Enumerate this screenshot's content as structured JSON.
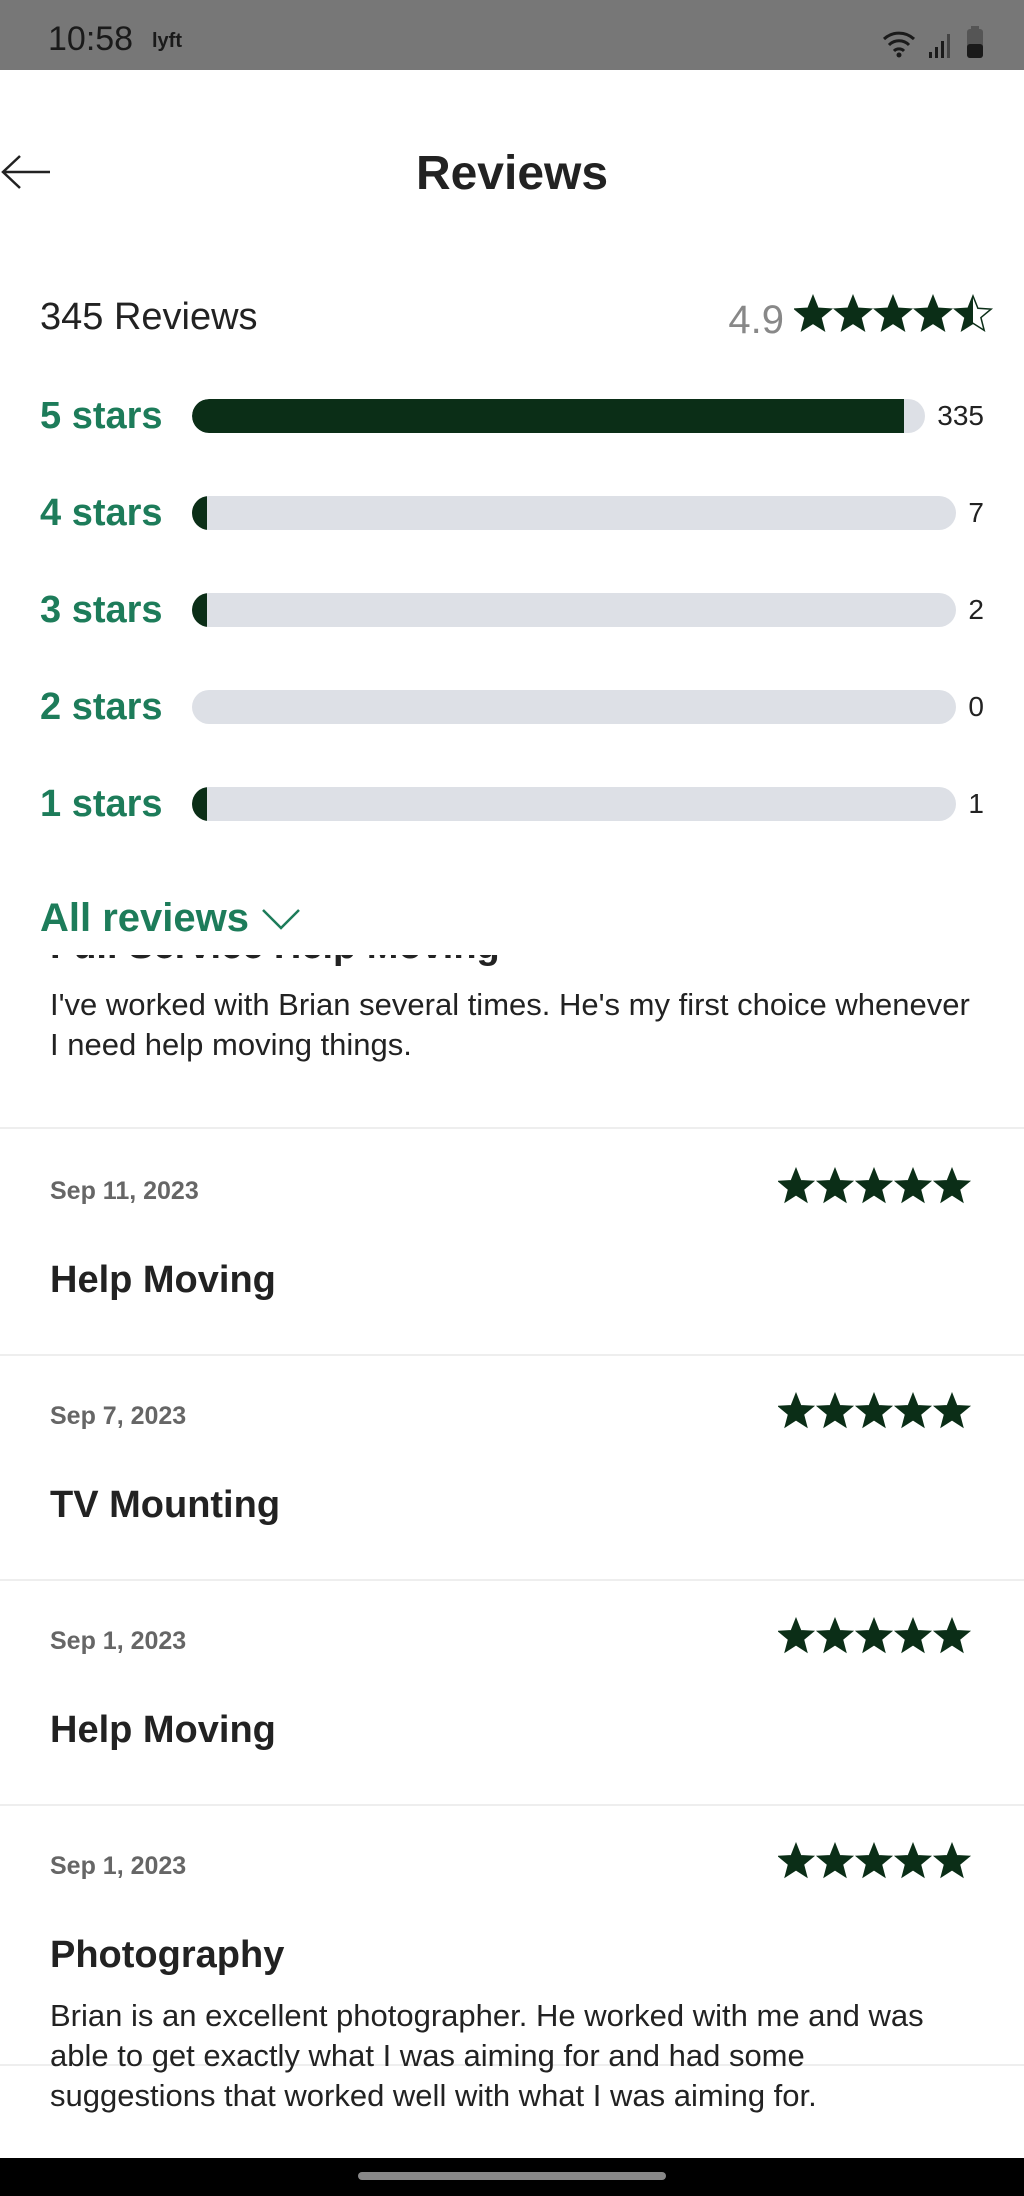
{
  "status_bar": {
    "time": "10:58",
    "app_badge": "lyft"
  },
  "header": {
    "title": "Reviews"
  },
  "summary": {
    "count_label": "345 Reviews",
    "average": "4.9",
    "average_value": 4.9,
    "star_color": "#0b2e17"
  },
  "breakdown": [
    {
      "label": "5 stars",
      "count": "335",
      "fraction": 0.971
    },
    {
      "label": "4 stars",
      "count": "7",
      "fraction": 0.02
    },
    {
      "label": "3 stars",
      "count": "2",
      "fraction": 0.02
    },
    {
      "label": "2 stars",
      "count": "0",
      "fraction": 0
    },
    {
      "label": "1 stars",
      "count": "1",
      "fraction": 0.02
    }
  ],
  "filter": {
    "label": "All reviews"
  },
  "reviews": [
    {
      "title": "Full Service Help Moving",
      "body": "I've worked with Brian several times.  He's my first choice whenever I need help moving things."
    },
    {
      "date": "Sep 11, 2023",
      "rating": 5,
      "title": "Help Moving"
    },
    {
      "date": "Sep 7, 2023",
      "rating": 5,
      "title": "TV Mounting"
    },
    {
      "date": "Sep 1, 2023",
      "rating": 5,
      "title": "Help Moving"
    },
    {
      "date": "Sep 1, 2023",
      "rating": 5,
      "title": "Photography",
      "body": "Brian is an excellent photographer. He worked with me and was able to get exactly what I was aiming for and had some suggestions that worked well with what I was aiming for."
    }
  ],
  "colors": {
    "accent": "#1d7c5a",
    "bar_fill": "#0b2e17",
    "bar_track": "#dde0e6"
  }
}
